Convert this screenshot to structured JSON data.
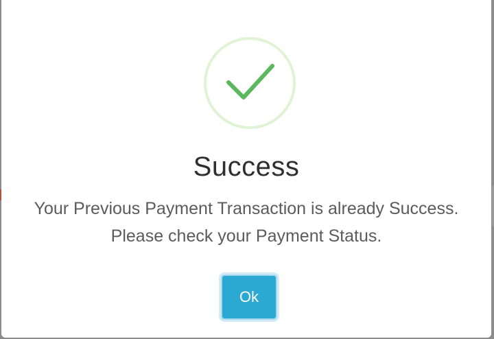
{
  "dialog": {
    "title": "Success",
    "message": "Your Previous Payment Transaction is already Success. Please check your Payment Status.",
    "ok_label": "Ok",
    "icon": "success-check-icon"
  },
  "colors": {
    "check": "#5cb85c",
    "ring": "#d9f0d0",
    "button": "#2ba9d3",
    "title": "#2f2f2f",
    "message": "#5b5b5b"
  }
}
